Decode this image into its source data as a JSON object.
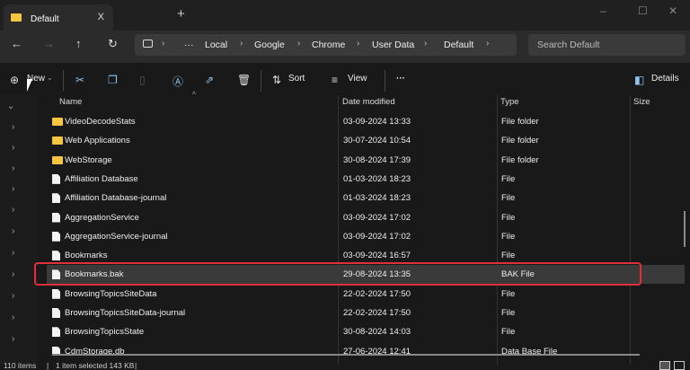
{
  "window": {
    "tab_title": "Default",
    "close": "X",
    "new_tab": "+",
    "minimize": "–",
    "maximize": "☐",
    "close_window": "✕"
  },
  "nav": {
    "back": "←",
    "forward": "→",
    "up": "↑",
    "refresh": "↻"
  },
  "breadcrumb": [
    "Local",
    "Google",
    "Chrome",
    "User Data",
    "Default"
  ],
  "breadcrumb_ellipsis": "···",
  "search": {
    "placeholder": "Search Default"
  },
  "toolbar": {
    "new": "New",
    "sort": "Sort",
    "view": "View",
    "more": "···",
    "details": "Details"
  },
  "columns": {
    "name": "Name",
    "date": "Date modified",
    "type": "Type",
    "size": "Size"
  },
  "files": [
    {
      "name": "VideoDecodeStats",
      "date": "03-09-2024 13:33",
      "type": "File folder",
      "kind": "folder"
    },
    {
      "name": "Web Applications",
      "date": "30-07-2024 10:54",
      "type": "File folder",
      "kind": "folder"
    },
    {
      "name": "WebStorage",
      "date": "30-08-2024 17:39",
      "type": "File folder",
      "kind": "folder"
    },
    {
      "name": "Affiliation Database",
      "date": "01-03-2024 18:23",
      "type": "File",
      "kind": "file"
    },
    {
      "name": "Affiliation Database-journal",
      "date": "01-03-2024 18:23",
      "type": "File",
      "kind": "file"
    },
    {
      "name": "AggregationService",
      "date": "03-09-2024 17:02",
      "type": "File",
      "kind": "file"
    },
    {
      "name": "AggregationService-journal",
      "date": "03-09-2024 17:02",
      "type": "File",
      "kind": "file"
    },
    {
      "name": "Bookmarks",
      "date": "03-09-2024 16:57",
      "type": "File",
      "kind": "file"
    },
    {
      "name": "Bookmarks.bak",
      "date": "29-08-2024 13:35",
      "type": "BAK File",
      "kind": "file",
      "selected": true
    },
    {
      "name": "BrowsingTopicsSiteData",
      "date": "22-02-2024 17:50",
      "type": "File",
      "kind": "file"
    },
    {
      "name": "BrowsingTopicsSiteData-journal",
      "date": "22-02-2024 17:50",
      "type": "File",
      "kind": "file"
    },
    {
      "name": "BrowsingTopicsState",
      "date": "30-08-2024 14:03",
      "type": "File",
      "kind": "file"
    },
    {
      "name": "CdmStorage.db",
      "date": "27-06-2024 12:41",
      "type": "Data Base File",
      "kind": "file"
    }
  ],
  "status": {
    "items": "110 items",
    "selected": "1 item selected  143 KB"
  },
  "colors": {
    "highlight": "#e0303a",
    "folder": "#f5c542",
    "accent": "#8ec5f0"
  }
}
